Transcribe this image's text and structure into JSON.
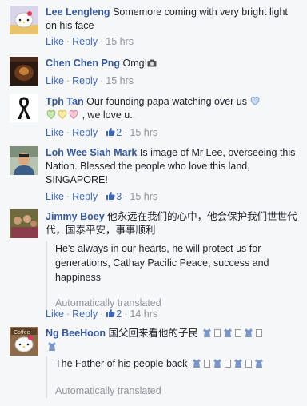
{
  "actions": {
    "like": "Like",
    "reply": "Reply",
    "sep": "·",
    "translated_note": "Automatically translated"
  },
  "colors": {
    "link": "#365899",
    "action": "#4267b2",
    "meta": "#90949c",
    "background": "#f6f7f9"
  },
  "comments": [
    {
      "author": "Lee Lengleng",
      "text": "Somemore coming with very bright light on his face",
      "time": "15 hrs",
      "likes": null,
      "avatar_icon": "hello-kitty-avatar"
    },
    {
      "author": "Chen Chen Png",
      "text": "Omg!",
      "emoji": "camera-emoji",
      "time": "15 hrs",
      "likes": null,
      "avatar_icon": "dark-photo-avatar"
    },
    {
      "author": "Tph Tan",
      "text_a": "Our founding papa watching over us",
      "text_b": ", we love u..",
      "emoji": [
        "blue-heart-emoji",
        "green-heart-emoji",
        "yellow-heart-emoji",
        "pink-heart-emoji"
      ],
      "time": "15 hrs",
      "likes": "2",
      "avatar_icon": "black-ribbon-avatar"
    },
    {
      "author": "Loh Wee Siah Mark",
      "text": "Is image of Mr Lee, overseeing this Nation. Blessed the people who love this land, SINGAPORE!",
      "time": "15 hrs",
      "likes": "3",
      "avatar_icon": "man-photo-avatar"
    },
    {
      "author": "Jimmy Boey",
      "text": "他永远在我们的心中，他会保护我们世世代代，国泰平安，事事顺利",
      "translation": "He's always in our hearts, he will protect us for generations, Cathay Pacific Peace, success and happiness",
      "time": "14 hrs",
      "likes": "2",
      "avatar_icon": "group-photo-avatar"
    },
    {
      "author": "Ng BeeHoon",
      "text": "国父回来看他的子民",
      "translation": "The Father of his people back",
      "emoji": "dress-emoji",
      "avatar_icon": "hello-kitty-coffee-avatar"
    }
  ]
}
